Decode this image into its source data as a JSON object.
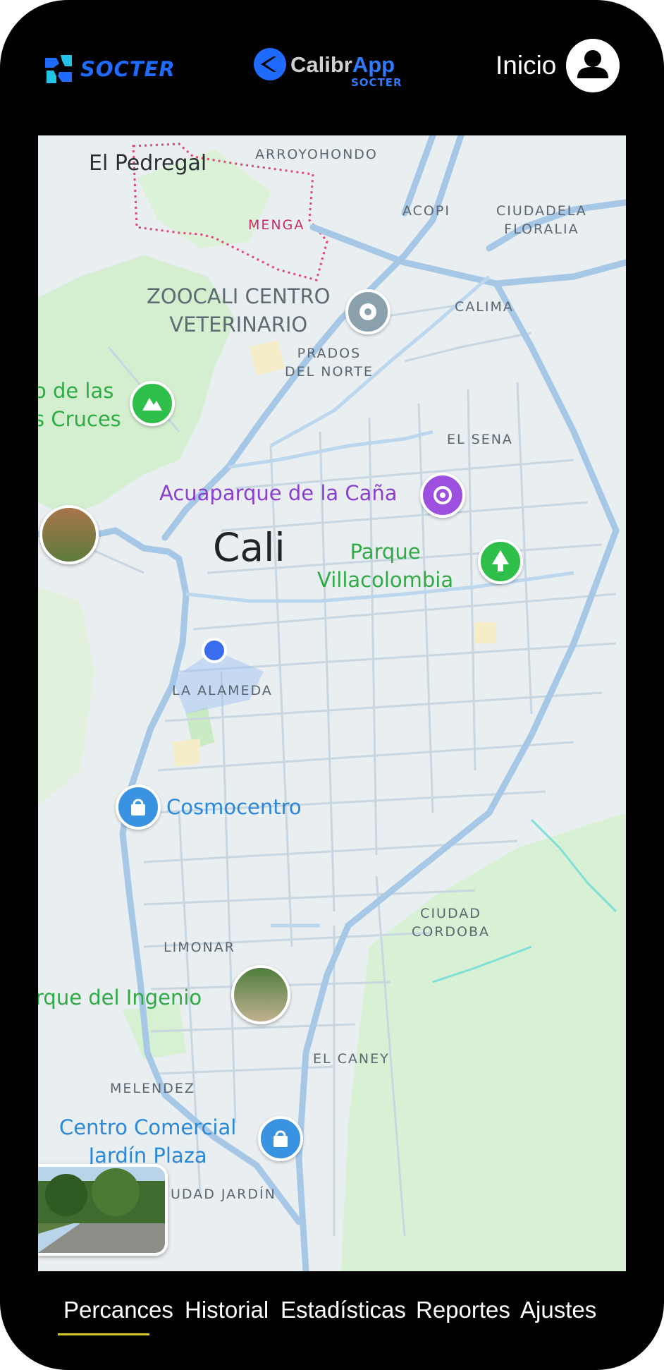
{
  "header": {
    "socter_logo_text": "SOCTER",
    "calibrapp_logo_main": "Calibr",
    "calibrapp_logo_app": "App",
    "calibrapp_logo_sub": "SOCTER",
    "inicio_label": "Inicio"
  },
  "map": {
    "areas": {
      "arroyohondo": "ARROYOHONDO",
      "menga": "MENGA",
      "acopi": "ACOPI",
      "ciudadela_floralia": [
        "CIUDADELA",
        "FLORALIA"
      ],
      "calima": "CALIMA",
      "prados_del_norte": [
        "PRADOS",
        "DEL NORTE"
      ],
      "el_sena": "EL SENA",
      "la_alameda": "LA ALAMEDA",
      "ciudad_cordoba": [
        "CIUDAD",
        "CORDOBA"
      ],
      "limonar": "LIMONAR",
      "el_caney": "EL CANEY",
      "melendez": "MELENDEZ",
      "ciudad_jardin": "UDAD JARDÍN"
    },
    "places": {
      "el_pedregal": "El Pedregal",
      "zoocali": [
        "ZOOCALI CENTRO",
        "VETERINARIO"
      ],
      "cerro_cruces": [
        "o de las",
        "s Cruces"
      ],
      "acuaparque": "Acuaparque de la Caña",
      "city": "Cali",
      "parque_villacolombia": [
        "Parque",
        "Villacolombia"
      ],
      "cosmocentro": "Cosmocentro",
      "parque_ingenio": "rque del Ingenio",
      "centro_comercial": [
        "Centro Comercial",
        "Jardín Plaza"
      ]
    }
  },
  "tabs": [
    {
      "label": "Percances",
      "active": true
    },
    {
      "label": "Historial",
      "active": false
    },
    {
      "label": "Estadísticas",
      "active": false
    },
    {
      "label": "Reportes",
      "active": false
    },
    {
      "label": "Ajustes",
      "active": false
    }
  ],
  "colors": {
    "brand_blue": "#1f6bff",
    "tab_underline": "#d6c82a",
    "road": "#9ec3e6",
    "park_green": "#d3f0cf",
    "poi_green": "#2fab43"
  }
}
